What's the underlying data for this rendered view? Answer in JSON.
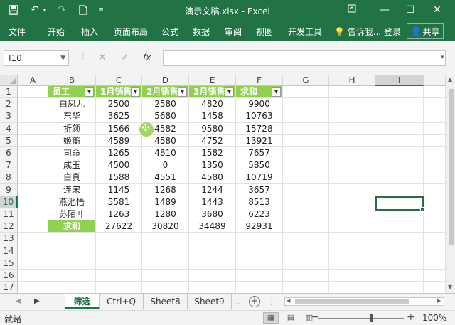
{
  "window": {
    "title": "演示文稿.xlsx - Excel"
  },
  "quick_access": {
    "save_icon": "save-icon",
    "undo_icon": "undo-icon",
    "redo_icon": "redo-icon",
    "new_icon": "new-document-icon",
    "customize_icon": "customize-qat-icon"
  },
  "ribbon": {
    "tabs": [
      "文件",
      "开始",
      "插入",
      "页面布局",
      "公式",
      "数据",
      "审阅",
      "视图",
      "开发工具"
    ],
    "tell_me": "告诉我...",
    "login": "登录",
    "share": "共享"
  },
  "formula_bar": {
    "name_box": "I10",
    "fx": "fx",
    "cancel": "✕",
    "enter": "✓",
    "content": ""
  },
  "columns": [
    "A",
    "B",
    "C",
    "D",
    "E",
    "F",
    "G",
    "H",
    "I"
  ],
  "rows": [
    "1",
    "2",
    "3",
    "4",
    "5",
    "6",
    "7",
    "8",
    "9",
    "10",
    "11",
    "12",
    "13",
    "14",
    "15",
    "16",
    "17"
  ],
  "table": {
    "headers": [
      "员工",
      "1月销售",
      "2月销售",
      "3月销售",
      "求和"
    ],
    "rows": [
      [
        "白凤九",
        "2500",
        "2580",
        "4820",
        "9900"
      ],
      [
        "东华",
        "3625",
        "5680",
        "1458",
        "10763"
      ],
      [
        "折颜",
        "1566",
        "4582",
        "9580",
        "15728"
      ],
      [
        "姬蘅",
        "4589",
        "4580",
        "4752",
        "13921"
      ],
      [
        "司命",
        "1265",
        "4810",
        "1582",
        "7657"
      ],
      [
        "成玉",
        "4500",
        "0",
        "1350",
        "5850"
      ],
      [
        "白真",
        "1588",
        "4551",
        "4580",
        "10719"
      ],
      [
        "连宋",
        "1145",
        "1268",
        "1244",
        "3657"
      ],
      [
        "燕池悟",
        "5581",
        "1489",
        "1443",
        "8513"
      ],
      [
        "苏陌叶",
        "1263",
        "1280",
        "3680",
        "6223"
      ]
    ],
    "total_row": [
      "求和",
      "27622",
      "30820",
      "34489",
      "92931"
    ]
  },
  "selected_cell": "I10",
  "sheets": [
    "筛选",
    "Ctrl+Q",
    "Sheet8",
    "Sheet9"
  ],
  "active_sheet": "筛选",
  "status": {
    "text": "就绪",
    "zoom": "100%",
    "zoom_minus": "−",
    "zoom_plus": "+"
  },
  "colors": {
    "accent": "#217346",
    "header_fill": "#92d050"
  }
}
